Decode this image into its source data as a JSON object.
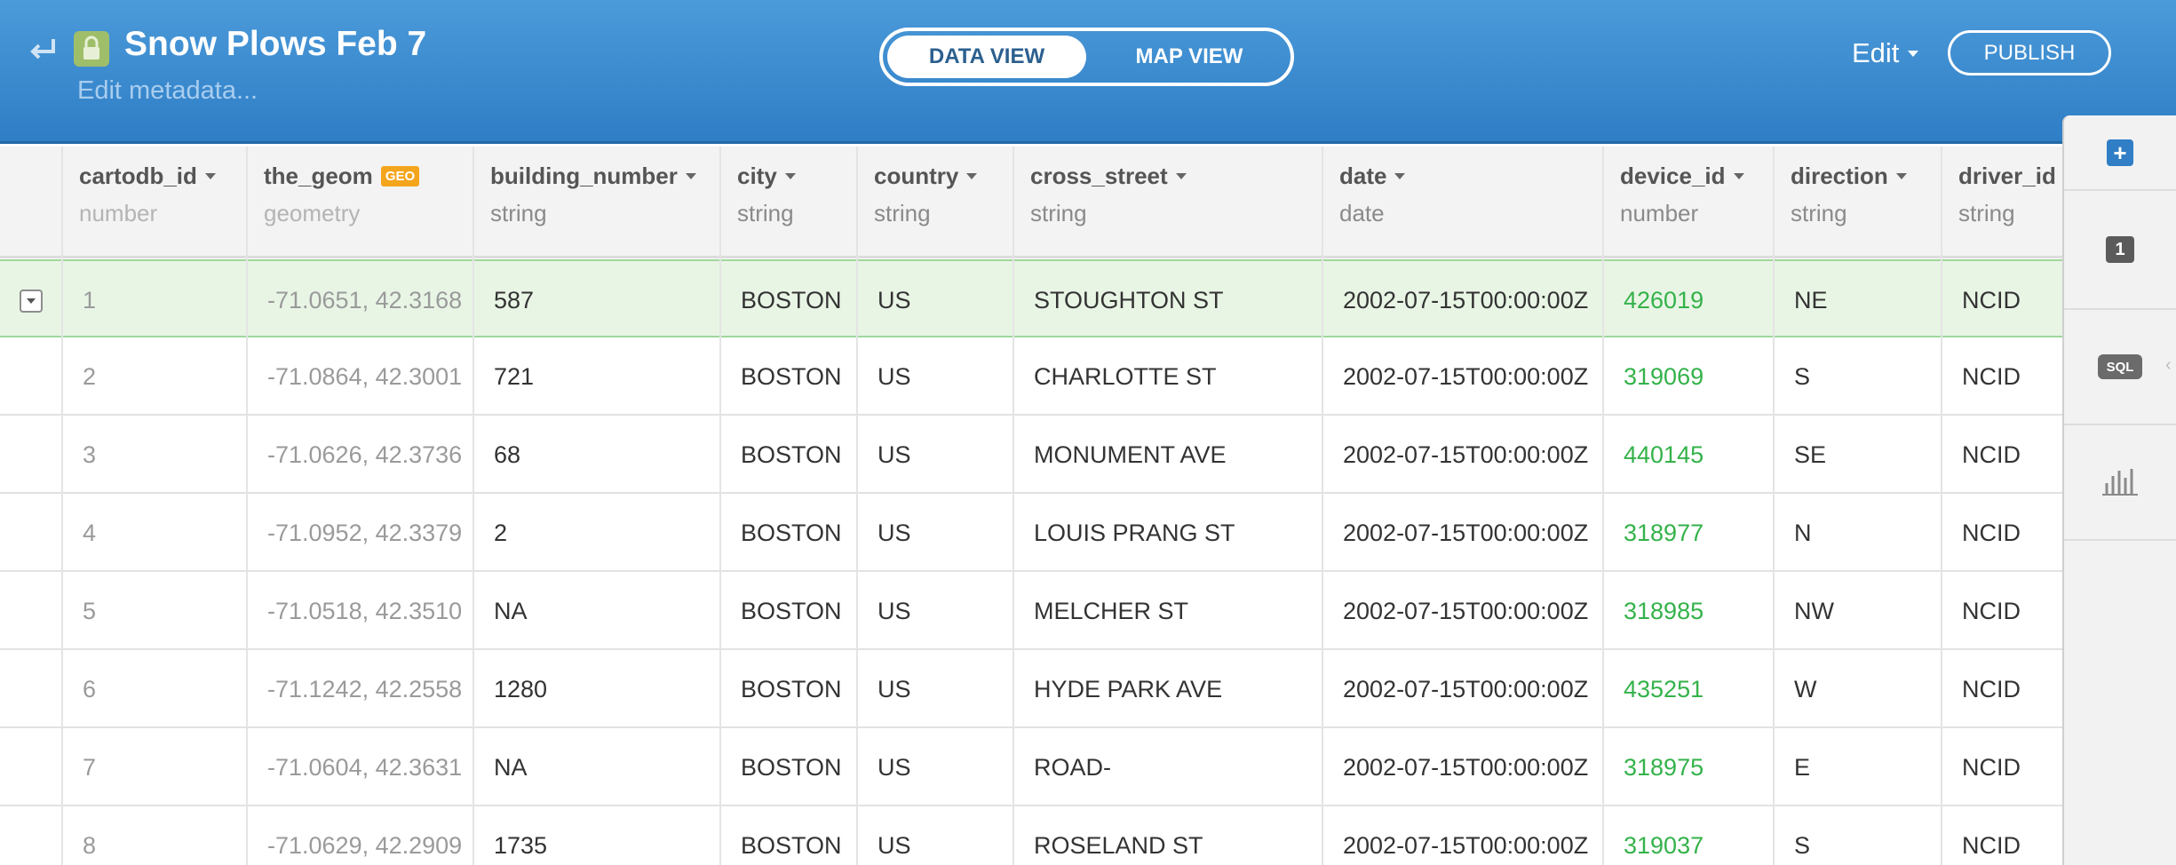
{
  "header": {
    "title": "Snow Plows Feb 7",
    "subtitle": "Edit metadata...",
    "data_view_label": "DATA VIEW",
    "map_view_label": "MAP VIEW",
    "edit_label": "Edit",
    "publish_label": "PUBLISH"
  },
  "table": {
    "columns": [
      {
        "name": "cartodb_id",
        "type": "number"
      },
      {
        "name": "the_geom",
        "type": "geometry",
        "badge": "GEO"
      },
      {
        "name": "building_number",
        "type": "string"
      },
      {
        "name": "city",
        "type": "string"
      },
      {
        "name": "country",
        "type": "string"
      },
      {
        "name": "cross_street",
        "type": "string"
      },
      {
        "name": "date",
        "type": "date"
      },
      {
        "name": "device_id",
        "type": "number"
      },
      {
        "name": "direction",
        "type": "string"
      },
      {
        "name": "driver_id",
        "type": "string"
      }
    ],
    "rows": [
      [
        "1",
        "-71.0651, 42.3168",
        "587",
        "BOSTON",
        "US",
        "STOUGHTON ST",
        "2002-07-15T00:00:00Z",
        "426019",
        "NE",
        "NCID"
      ],
      [
        "2",
        "-71.0864, 42.3001",
        "721",
        "BOSTON",
        "US",
        "CHARLOTTE ST",
        "2002-07-15T00:00:00Z",
        "319069",
        "S",
        "NCID"
      ],
      [
        "3",
        "-71.0626, 42.3736",
        "68",
        "BOSTON",
        "US",
        "MONUMENT AVE",
        "2002-07-15T00:00:00Z",
        "440145",
        "SE",
        "NCID"
      ],
      [
        "4",
        "-71.0952, 42.3379",
        "2",
        "BOSTON",
        "US",
        "LOUIS PRANG ST",
        "2002-07-15T00:00:00Z",
        "318977",
        "N",
        "NCID"
      ],
      [
        "5",
        "-71.0518, 42.3510",
        "NA",
        "BOSTON",
        "US",
        "MELCHER ST",
        "2002-07-15T00:00:00Z",
        "318985",
        "NW",
        "NCID"
      ],
      [
        "6",
        "-71.1242, 42.2558",
        "1280",
        "BOSTON",
        "US",
        "HYDE PARK AVE",
        "2002-07-15T00:00:00Z",
        "435251",
        "W",
        "NCID"
      ],
      [
        "7",
        "-71.0604, 42.3631",
        "NA",
        "BOSTON",
        "US",
        "ROAD-",
        "2002-07-15T00:00:00Z",
        "318975",
        "E",
        "NCID"
      ],
      [
        "8",
        "-71.0629, 42.2909",
        "1735",
        "BOSTON",
        "US",
        "ROSELAND ST",
        "2002-07-15T00:00:00Z",
        "319037",
        "S",
        "NCID"
      ]
    ]
  },
  "sidebar": {
    "layer_count": "1",
    "sql_label": "SQL",
    "add_label": "+"
  },
  "colors": {
    "header": "#3a8bd0",
    "selected_row": "#e8f5e5",
    "number_value": "#34b24a",
    "geo_badge": "#f4a51c"
  }
}
